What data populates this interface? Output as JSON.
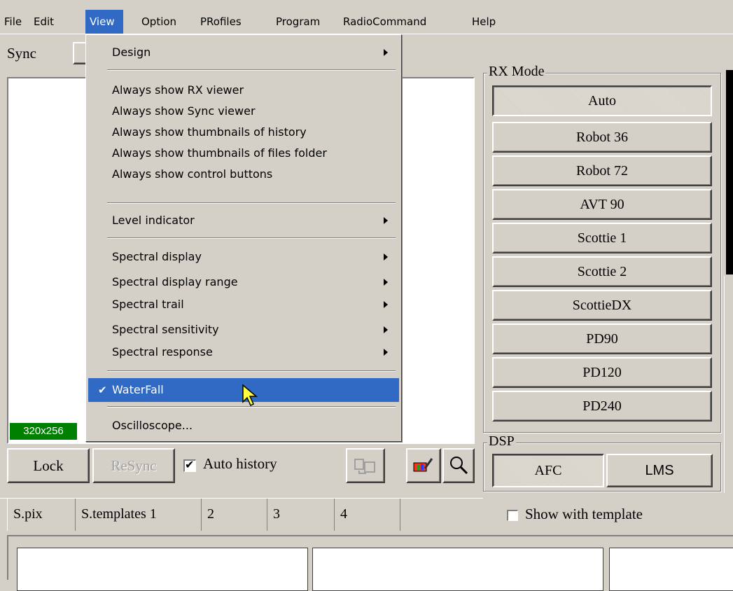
{
  "menubar": {
    "items": [
      "File",
      "Edit",
      "View",
      "Option",
      "PRofiles",
      "Program",
      "RadioCommand",
      "Help"
    ],
    "open_item": "View"
  },
  "view_menu": {
    "design": "Design",
    "always_show_rx": "Always show RX viewer",
    "always_show_sync": "Always show Sync viewer",
    "always_show_history_thumbs": "Always show thumbnails of history",
    "always_show_folder_thumbs": "Always show thumbnails of files folder",
    "always_show_controls": "Always show control buttons",
    "level_indicator": "Level indicator",
    "spectral_display": "Spectral display",
    "spectral_display_range": "Spectral display range",
    "spectral_trail": "Spectral trail",
    "spectral_sensitivity": "Spectral sensitivity",
    "spectral_response": "Spectral response",
    "waterfall": "WaterFall",
    "waterfall_checked": true,
    "oscilloscope": "Oscilloscope..."
  },
  "sync": {
    "label": "Sync",
    "resolution_badge": "320x256",
    "badge_color": "#008000"
  },
  "controls": {
    "lock": "Lock",
    "resync": "ReSync",
    "auto_history_label": "Auto history",
    "auto_history_checked": true
  },
  "rx_mode": {
    "title": "RX Mode",
    "selected": "Auto",
    "modes": [
      "Auto",
      "Robot 36",
      "Robot 72",
      "AVT 90",
      "Scottie 1",
      "Scottie 2",
      "ScottieDX",
      "PD90",
      "PD120",
      "PD240"
    ]
  },
  "dsp": {
    "title": "DSP",
    "afc": "AFC",
    "lms": "LMS"
  },
  "tabs": {
    "items": [
      "S.pix",
      "S.templates 1",
      "2",
      "3",
      "4"
    ],
    "active": "S.pix"
  },
  "show_with_template": {
    "label": "Show with template",
    "checked": false
  },
  "icons": [
    "copy-icon",
    "paint-icon",
    "magnifier-icon",
    "checkmark-icon",
    "submenu-arrow-icon",
    "cursor-icon"
  ],
  "colors": {
    "face": "#d4d0c8",
    "highlight": "#316ac5"
  }
}
